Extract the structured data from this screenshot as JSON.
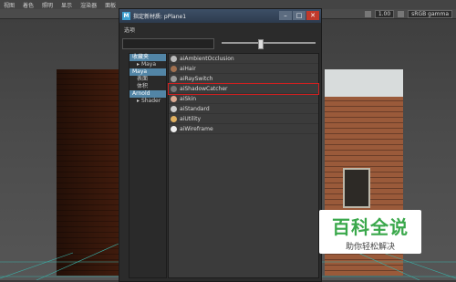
{
  "menu": [
    "视图",
    "着色",
    "照明",
    "显示",
    "渲染器",
    "面板"
  ],
  "toolbar": {
    "value": "1.00",
    "colorspace": "sRGB gamma"
  },
  "dialog": {
    "title": "指定新材质: pPlane1",
    "options_label": "选项",
    "tree": [
      {
        "label": "收藏夹",
        "selected": true,
        "indent": false
      },
      {
        "label": "Maya",
        "selected": false,
        "indent": true
      },
      {
        "label": "Maya",
        "selected": true,
        "indent": false
      },
      {
        "label": "表面",
        "selected": false,
        "indent": true
      },
      {
        "label": "体积",
        "selected": false,
        "indent": true
      },
      {
        "label": "Arnold",
        "selected": true,
        "indent": false
      },
      {
        "label": "Shader",
        "selected": false,
        "indent": true
      }
    ],
    "materials": [
      {
        "label": "aiAmbientOcclusion",
        "icon": "sphere-icon",
        "highlight": false
      },
      {
        "label": "aiHair",
        "icon": "hair-icon",
        "highlight": false
      },
      {
        "label": "aiRaySwitch",
        "icon": "sphere-icon",
        "highlight": false
      },
      {
        "label": "aiShadowCatcher",
        "icon": "sphere-icon",
        "highlight": true
      },
      {
        "label": "aiSkin",
        "icon": "sphere-icon",
        "highlight": false
      },
      {
        "label": "aiStandard",
        "icon": "sphere-icon",
        "highlight": false
      },
      {
        "label": "aiUtility",
        "icon": "sphere-icon",
        "highlight": false
      },
      {
        "label": "aiWireframe",
        "icon": "sphere-icon",
        "highlight": false
      }
    ]
  },
  "watermark": {
    "title": "百科全说",
    "subtitle": "助你轻松解决"
  }
}
